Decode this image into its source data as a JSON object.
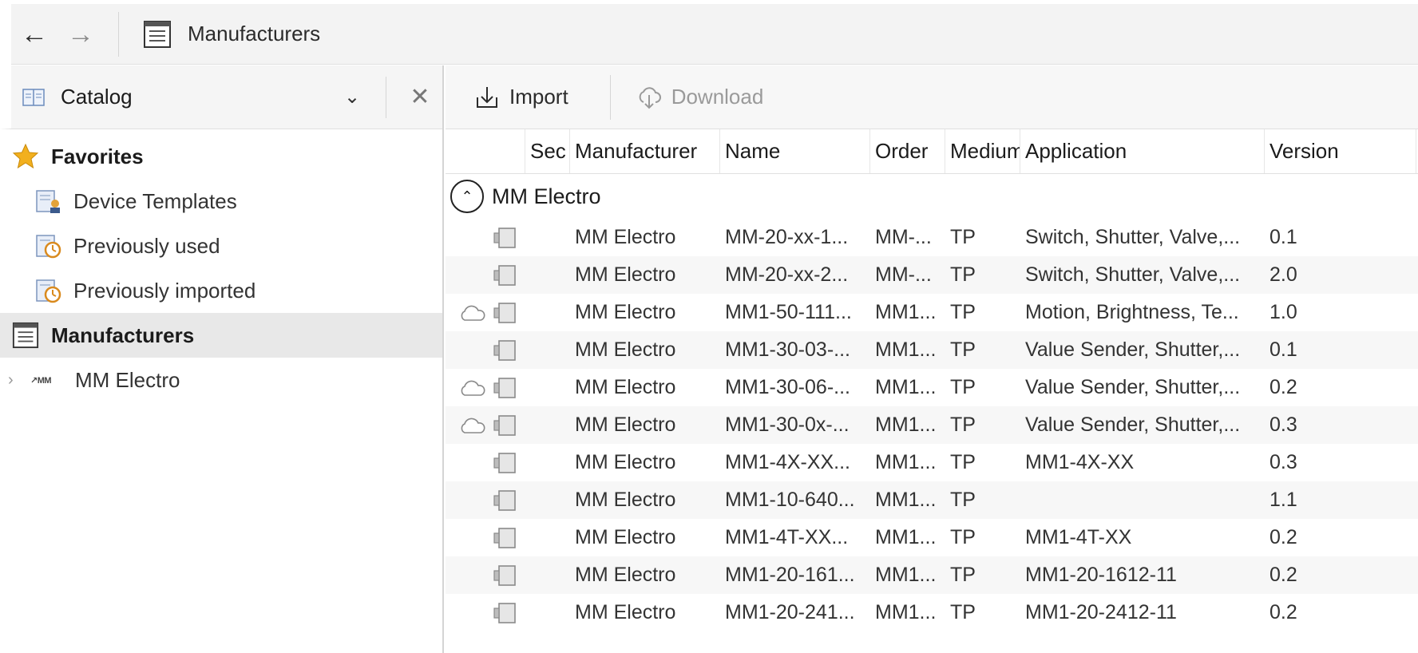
{
  "header": {
    "title": "Manufacturers",
    "back_icon": "arrow-left-icon",
    "forward_icon": "arrow-right-icon"
  },
  "catalog": {
    "label": "Catalog"
  },
  "tree": {
    "favorites": "Favorites",
    "device_templates": "Device Templates",
    "previously_used": "Previously used",
    "previously_imported": "Previously imported",
    "manufacturers": "Manufacturers",
    "mm_electro": "MM Electro",
    "mm_logo": "↗MM"
  },
  "toolbar": {
    "import_label": "Import",
    "download_label": "Download"
  },
  "columns": [
    "Sec",
    "Manufacturer",
    "Name",
    "Order",
    "Medium",
    "Application",
    "Version"
  ],
  "group": {
    "name": "MM Electro"
  },
  "rows": [
    {
      "cloud": false,
      "manufacturer": "MM Electro",
      "name": "MM-20-xx-1...",
      "order": "MM-...",
      "medium": "TP",
      "application": "Switch, Shutter, Valve,...",
      "version": "0.1"
    },
    {
      "cloud": false,
      "manufacturer": "MM Electro",
      "name": "MM-20-xx-2...",
      "order": "MM-...",
      "medium": "TP",
      "application": "Switch, Shutter, Valve,...",
      "version": "2.0"
    },
    {
      "cloud": true,
      "manufacturer": "MM Electro",
      "name": "MM1-50-111...",
      "order": "MM1...",
      "medium": "TP",
      "application": "Motion, Brightness, Te...",
      "version": "1.0"
    },
    {
      "cloud": false,
      "manufacturer": "MM Electro",
      "name": "MM1-30-03-...",
      "order": "MM1...",
      "medium": "TP",
      "application": "Value Sender, Shutter,...",
      "version": "0.1"
    },
    {
      "cloud": true,
      "manufacturer": "MM Electro",
      "name": "MM1-30-06-...",
      "order": "MM1...",
      "medium": "TP",
      "application": "Value Sender, Shutter,...",
      "version": "0.2"
    },
    {
      "cloud": true,
      "manufacturer": "MM Electro",
      "name": "MM1-30-0x-...",
      "order": "MM1...",
      "medium": "TP",
      "application": "Value Sender, Shutter,...",
      "version": "0.3"
    },
    {
      "cloud": false,
      "manufacturer": "MM Electro",
      "name": "MM1-4X-XX...",
      "order": "MM1...",
      "medium": "TP",
      "application": "MM1-4X-XX",
      "version": "0.3"
    },
    {
      "cloud": false,
      "manufacturer": "MM Electro",
      "name": "MM1-10-640...",
      "order": "MM1...",
      "medium": "TP",
      "application": "",
      "version": "1.1"
    },
    {
      "cloud": false,
      "manufacturer": "MM Electro",
      "name": "MM1-4T-XX...",
      "order": "MM1...",
      "medium": "TP",
      "application": "MM1-4T-XX",
      "version": "0.2"
    },
    {
      "cloud": false,
      "manufacturer": "MM Electro",
      "name": "MM1-20-161...",
      "order": "MM1...",
      "medium": "TP",
      "application": "MM1-20-1612-11",
      "version": "0.2"
    },
    {
      "cloud": false,
      "manufacturer": "MM Electro",
      "name": "MM1-20-241...",
      "order": "MM1...",
      "medium": "TP",
      "application": "MM1-20-2412-11",
      "version": "0.2"
    }
  ]
}
